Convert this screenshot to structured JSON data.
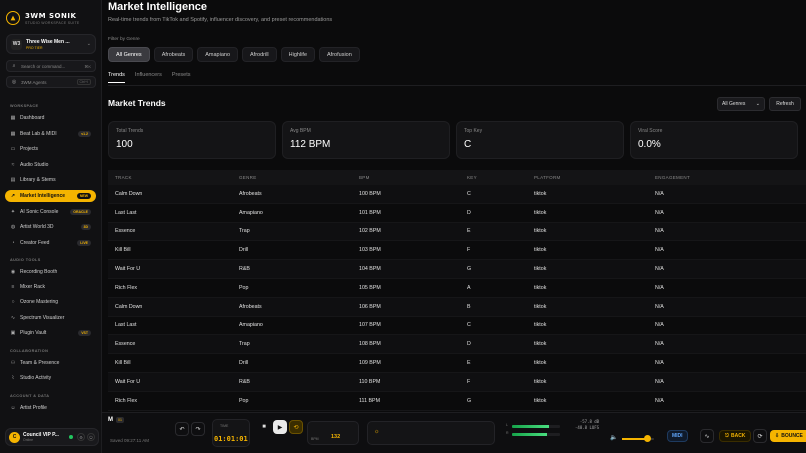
{
  "brand": {
    "title": "3WM SONIK",
    "subtitle": "STUDIO WORKSPACE SUITE"
  },
  "workspace": {
    "avatar": "W3",
    "name": "Three Wise Men ...",
    "tier": "PRO TIER"
  },
  "search": {
    "placeholder": "Search or command...",
    "shortcut": "⌘K"
  },
  "agents": {
    "label": "3WM Agents",
    "shortcut": "Ctrl+I"
  },
  "sections": {
    "workspace": "WORKSPACE",
    "audio_tools": "AUDIO TOOLS",
    "collaboration": "COLLABORATION",
    "account": "ACCOUNT & DATA"
  },
  "nav": {
    "workspace": [
      {
        "label": "Dashboard",
        "icon": "grid-icon",
        "badge": ""
      },
      {
        "label": "Beat Lab & MIDI",
        "icon": "grid-icon",
        "badge": "v1.2"
      },
      {
        "label": "Projects",
        "icon": "folder-icon",
        "badge": ""
      },
      {
        "label": "Audio Studio",
        "icon": "wave-icon",
        "badge": ""
      },
      {
        "label": "Library & Stems",
        "icon": "library-icon",
        "badge": ""
      },
      {
        "label": "Market Intelligence",
        "icon": "trend-icon",
        "badge": "NEW"
      },
      {
        "label": "AI Sonic Console",
        "icon": "sparkle-icon",
        "badge": "ORACLE"
      },
      {
        "label": "Artist World 3D",
        "icon": "globe-icon",
        "badge": "3D"
      },
      {
        "label": "Creator Feed",
        "icon": "rss-icon",
        "badge": "LIVE"
      }
    ],
    "audio_tools": [
      {
        "label": "Recording Booth",
        "icon": "mic-icon",
        "badge": ""
      },
      {
        "label": "Mixer Rack",
        "icon": "sliders-icon",
        "badge": ""
      },
      {
        "label": "Ozone Mastering",
        "icon": "circle-icon",
        "badge": ""
      },
      {
        "label": "Spectrum Visualizer",
        "icon": "spectrum-icon",
        "badge": ""
      },
      {
        "label": "Plugin Vault",
        "icon": "box-icon",
        "badge": "VST"
      }
    ],
    "collaboration": [
      {
        "label": "Team & Presence",
        "icon": "users-icon",
        "badge": ""
      },
      {
        "label": "Studio Activity",
        "icon": "activity-icon",
        "badge": ""
      }
    ],
    "account": [
      {
        "label": "Artist Profile",
        "icon": "user-icon",
        "badge": ""
      }
    ]
  },
  "user": {
    "initial": "C",
    "name": "Council VIP P...",
    "sub": "Online"
  },
  "main": {
    "title": "Market Intelligence",
    "subtitle": "Real-time trends from TikTok and Spotify, influencer discovery, and preset recommendations",
    "filter_label": "Filter by Genre",
    "genres": [
      "All Genres",
      "Afrobeats",
      "Amapiano",
      "Afrodrill",
      "Highlife",
      "Afrofusion"
    ],
    "tabs": [
      "Trends",
      "Influencers",
      "Presets"
    ],
    "section_title": "Market Trends",
    "select_value": "All Genres",
    "refresh_label": "Refresh",
    "stats": [
      {
        "label": "Total Trends",
        "value": "100"
      },
      {
        "label": "Avg BPM",
        "value": "112 BPM"
      },
      {
        "label": "Top Key",
        "value": "C"
      },
      {
        "label": "Viral Score",
        "value": "0.0%"
      }
    ],
    "table": {
      "headers": [
        "TRACK",
        "GENRE",
        "BPM",
        "KEY",
        "PLATFORM",
        "ENGAGEMENT"
      ],
      "rows": [
        [
          "Calm Down",
          "Afrobeats",
          "100 BPM",
          "C",
          "tiktok",
          "N/A"
        ],
        [
          "Last Last",
          "Amapiano",
          "101 BPM",
          "D",
          "tiktok",
          "N/A"
        ],
        [
          "Essence",
          "Trap",
          "102 BPM",
          "E",
          "tiktok",
          "N/A"
        ],
        [
          "Kill Bill",
          "Drill",
          "103 BPM",
          "F",
          "tiktok",
          "N/A"
        ],
        [
          "Wait For U",
          "R&B",
          "104 BPM",
          "G",
          "tiktok",
          "N/A"
        ],
        [
          "Rich Flex",
          "Pop",
          "105 BPM",
          "A",
          "tiktok",
          "N/A"
        ],
        [
          "Calm Down",
          "Afrobeats",
          "106 BPM",
          "B",
          "tiktok",
          "N/A"
        ],
        [
          "Last Last",
          "Amapiano",
          "107 BPM",
          "C",
          "tiktok",
          "N/A"
        ],
        [
          "Essence",
          "Trap",
          "108 BPM",
          "D",
          "tiktok",
          "N/A"
        ],
        [
          "Kill Bill",
          "Drill",
          "109 BPM",
          "E",
          "tiktok",
          "N/A"
        ],
        [
          "Wait For U",
          "R&B",
          "110 BPM",
          "F",
          "tiktok",
          "N/A"
        ],
        [
          "Rich Flex",
          "Pop",
          "111 BPM",
          "G",
          "tiktok",
          "N/A"
        ]
      ]
    }
  },
  "transport": {
    "m_label": "M",
    "m_badge": "01",
    "saved": "Saved 09:27:11 AM",
    "time_label": "TIME",
    "time": "01:01:01",
    "bpm_label": "BPM",
    "bpm": "132",
    "db_left": "-57.8 dB",
    "db_right": "-48.8 LUFS",
    "midi": "MIDI",
    "back": "BACK",
    "bounce": "BOUNCE",
    "volume": 0.8
  },
  "colors": {
    "accent": "#f5b400",
    "background": "#0b0b0c",
    "success": "#22c55e",
    "midi": "#60a5fa"
  }
}
